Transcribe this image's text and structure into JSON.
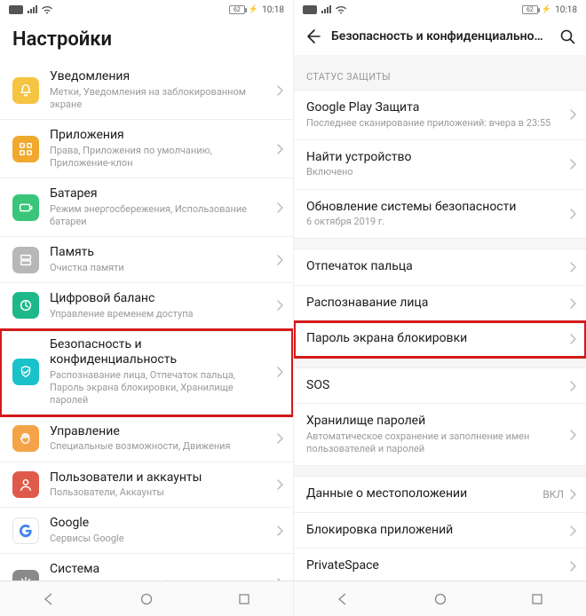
{
  "status": {
    "battery": "62",
    "time": "10:18"
  },
  "left": {
    "page_title": "Настройки",
    "rows": [
      {
        "title": "Уведомления",
        "sub": "Метки, Уведомления на заблокированном экране",
        "icon": "bell",
        "bg": "#f6c443"
      },
      {
        "title": "Приложения",
        "sub": "Права, Приложения по умолчанию, Приложение-клон",
        "icon": "grid",
        "bg": "#f0a92e"
      },
      {
        "title": "Батарея",
        "sub": "Режим энергосбережения, Использование батареи",
        "icon": "battery",
        "bg": "#39c57a"
      },
      {
        "title": "Память",
        "sub": "Очистка памяти",
        "icon": "storage",
        "bg": "#b7b7b7"
      },
      {
        "title": "Цифровой баланс",
        "sub": "Управление временем доступа",
        "icon": "balance",
        "bg": "#1db889"
      },
      {
        "title": "Безопасность и конфиденциальность",
        "sub": "Распознавание лица, Отпечаток пальца, Пароль экрана блокировки, Хранилище паролей",
        "icon": "shield",
        "bg": "#19c1c9",
        "highlight": true
      },
      {
        "title": "Управление",
        "sub": "Специальные возможности, Движения",
        "icon": "hand",
        "bg": "#f5a348"
      },
      {
        "title": "Пользователи и аккаунты",
        "sub": "Пользователи, Аккаунты",
        "icon": "user",
        "bg": "#e05a4b"
      },
      {
        "title": "Google",
        "sub": "Сервисы Google",
        "icon": "google",
        "bg": "#ffffff"
      },
      {
        "title": "Система",
        "sub": "Системная навигация, Обновление ПО, О телефоне, Язык и ввод",
        "icon": "system",
        "bg": "#8a8a8a"
      }
    ]
  },
  "right": {
    "app_title": "Безопасность и конфиденциальность",
    "section_header": "СТАТУС ЗАЩИТЫ",
    "group1": [
      {
        "title": "Google Play Защита",
        "sub": "Последнее сканирование приложений: вчера в 23:55"
      },
      {
        "title": "Найти устройство",
        "sub": "Включено"
      },
      {
        "title": "Обновление системы безопасности",
        "sub": "6 октября 2019 г."
      }
    ],
    "group2": [
      {
        "title": "Отпечаток пальца"
      },
      {
        "title": "Распознавание лица"
      },
      {
        "title": "Пароль экрана блокировки",
        "highlight": true
      }
    ],
    "group3": [
      {
        "title": "SOS"
      },
      {
        "title": "Хранилище паролей",
        "sub": "Автоматическое сохранение и заполнение имен пользователей и паролей"
      }
    ],
    "group4": [
      {
        "title": "Данные о местоположении",
        "value": "ВКЛ"
      },
      {
        "title": "Блокировка приложений"
      },
      {
        "title": "PrivateSpace"
      }
    ]
  }
}
